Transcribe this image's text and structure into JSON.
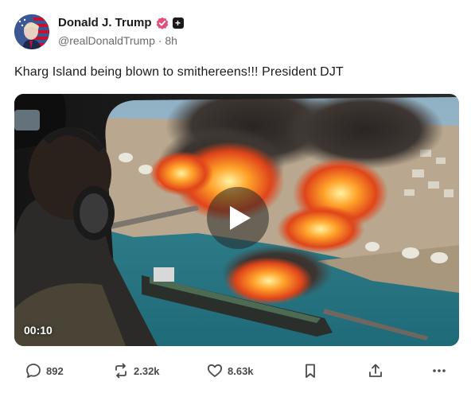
{
  "post": {
    "author": {
      "display_name": "Donald J. Trump",
      "handle": "@realDonaldTrump",
      "separator": "·",
      "time_ago": "8h",
      "verified_color": "#e0507a",
      "avatar_icon": "flag-portrait-avatar"
    },
    "text": "Kharg Island being blown to smithereens!!! President DJT",
    "media": {
      "type": "video",
      "duration": "00:10",
      "play_icon": "play-icon"
    },
    "actions": {
      "replies": {
        "icon": "comment-icon",
        "count": "892"
      },
      "reposts": {
        "icon": "repost-icon",
        "count": "2.32k"
      },
      "likes": {
        "icon": "heart-icon",
        "count": "8.63k"
      },
      "bookmark": {
        "icon": "bookmark-icon"
      },
      "share": {
        "icon": "share-icon"
      },
      "more": {
        "icon": "more-icon"
      }
    }
  }
}
